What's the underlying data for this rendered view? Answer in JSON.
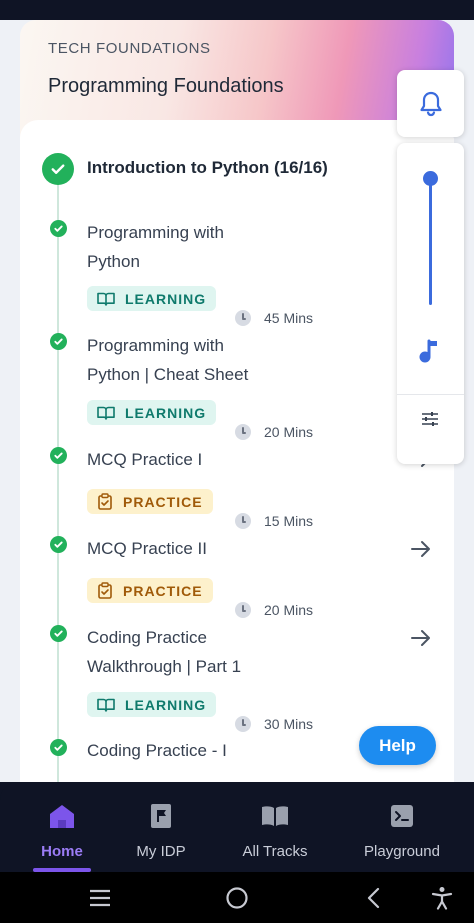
{
  "header": {
    "eyebrow": "TECH FOUNDATIONS",
    "title": "Programming Foundations"
  },
  "section": {
    "title": "Introduction to Python (16/16)"
  },
  "items": [
    {
      "title_line1": "Programming with",
      "title_line2": "Python",
      "badge": "LEARNING",
      "duration": "45 Mins",
      "has_arrow": false
    },
    {
      "title_line1": "Programming with",
      "title_line2": "Python | Cheat Sheet",
      "badge": "LEARNING",
      "duration": "20 Mins",
      "has_arrow": false
    },
    {
      "title_line1": "MCQ Practice I",
      "title_line2": "",
      "badge": "PRACTICE",
      "duration": "15 Mins",
      "has_arrow": true
    },
    {
      "title_line1": "MCQ Practice II",
      "title_line2": "",
      "badge": "PRACTICE",
      "duration": "20 Mins",
      "has_arrow": true
    },
    {
      "title_line1": "Coding Practice",
      "title_line2": "Walkthrough | Part 1",
      "badge": "LEARNING",
      "duration": "30 Mins",
      "has_arrow": true
    },
    {
      "title_line1": "Coding Practice - I",
      "title_line2": "",
      "badge": "",
      "duration": "",
      "has_arrow": false
    }
  ],
  "side_panel": {
    "icons": [
      "bell-icon",
      "volume-slider",
      "music-note-icon",
      "equalizer-icon"
    ],
    "slider_level": 1.0
  },
  "help_button": {
    "label": "Help"
  },
  "bottom_nav": [
    {
      "label": "Home",
      "icon": "home-icon",
      "active": true
    },
    {
      "label": "My IDP",
      "icon": "flag-document-icon",
      "active": false
    },
    {
      "label": "All Tracks",
      "icon": "open-book-icon",
      "active": false
    },
    {
      "label": "Playground",
      "icon": "terminal-icon",
      "active": false
    }
  ],
  "colors": {
    "accent": "#7c55ea",
    "check_green": "#22b15b",
    "learning_bg": "#dff5f0",
    "learning_text": "#0f7a6c",
    "practice_bg": "#fdf1cc",
    "practice_text": "#a05a09",
    "help_blue": "#1d8cf0"
  }
}
